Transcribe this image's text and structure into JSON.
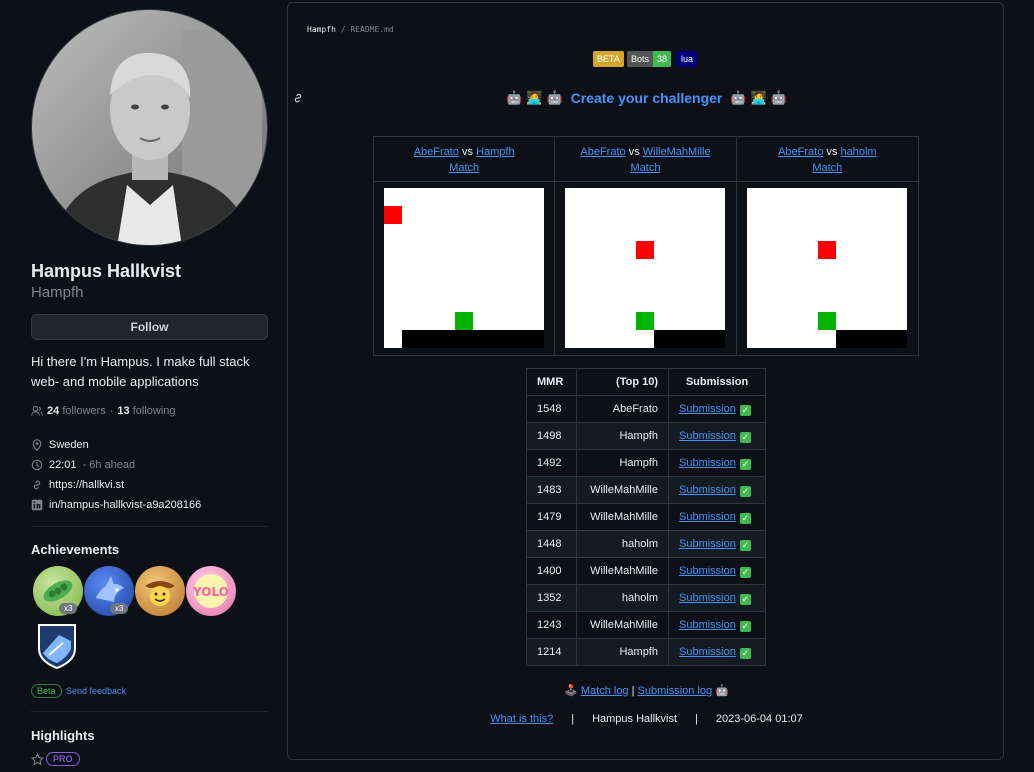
{
  "profile": {
    "name": "Hampus Hallkvist",
    "username": "Hampfh",
    "follow_label": "Follow",
    "bio": "Hi there I'm Hampus. I make full stack web- and mobile applications",
    "followers_count": "24",
    "followers_label": "followers",
    "dot": "·",
    "following_count": "13",
    "following_label": "following",
    "location": "Sweden",
    "time": "22:01",
    "time_note": "- 6h ahead",
    "website": "https://hallkvi.st",
    "linkedin": "in/hampus-hallkvist-a9a208166"
  },
  "achievements": {
    "title": "Achievements",
    "badges": [
      {
        "icon": "pair-extraordinaire-icon",
        "count": "x3",
        "color": "#8bc34a"
      },
      {
        "icon": "shark-icon",
        "count": "x3",
        "color": "#1e4fb4"
      },
      {
        "icon": "cowboy-icon",
        "count": "",
        "color": "#d8a24a"
      },
      {
        "icon": "yolo-icon",
        "count": "",
        "color": "#f08fbf"
      },
      {
        "icon": "arctic-code-vault-icon",
        "count": "",
        "color": "#1f3a6e"
      }
    ],
    "beta_label": "Beta",
    "feedback_label": "Send feedback"
  },
  "highlights": {
    "title": "Highlights",
    "pro_label": "PRO"
  },
  "readme": {
    "owner": "Hampfh",
    "slash": "/",
    "file": "README.md",
    "shields": [
      {
        "label": "BETA",
        "color": "#d4a72c"
      },
      {
        "label": "Bots",
        "value": "38",
        "color": "#555555",
        "value_color": "#3fb950"
      },
      {
        "label": "lua",
        "color": "#000080"
      }
    ],
    "challenge_text": "Create your challenger",
    "matches": [
      {
        "p1": "AbeFrato",
        "vs": "vs",
        "p2": "Hampfh",
        "match": "Match"
      },
      {
        "p1": "AbeFrato",
        "vs": "vs",
        "p2": "WilleMahMille",
        "match": "Match"
      },
      {
        "p1": "AbeFrato",
        "vs": "vs",
        "p2": "haholm",
        "match": "Match"
      }
    ],
    "table": {
      "headers": [
        "MMR",
        "(Top 10)",
        "Submission"
      ],
      "rows": [
        {
          "mmr": "1548",
          "name": "AbeFrato",
          "link": "Submission"
        },
        {
          "mmr": "1498",
          "name": "Hampfh",
          "link": "Submission"
        },
        {
          "mmr": "1492",
          "name": "Hampfh",
          "link": "Submission"
        },
        {
          "mmr": "1483",
          "name": "WilleMahMille",
          "link": "Submission"
        },
        {
          "mmr": "1479",
          "name": "WilleMahMille",
          "link": "Submission"
        },
        {
          "mmr": "1448",
          "name": "haholm",
          "link": "Submission"
        },
        {
          "mmr": "1400",
          "name": "WilleMahMille",
          "link": "Submission"
        },
        {
          "mmr": "1352",
          "name": "haholm",
          "link": "Submission"
        },
        {
          "mmr": "1243",
          "name": "WilleMahMille",
          "link": "Submission"
        },
        {
          "mmr": "1214",
          "name": "Hampfh",
          "link": "Submission"
        }
      ]
    },
    "match_log": "Match log",
    "pipe": "|",
    "submission_log": "Submission log",
    "footer": {
      "what": "What is this?",
      "sep": "|",
      "author": "Hampus Hallkvist",
      "date": "2023-06-04 01:07"
    }
  },
  "colors": {
    "link": "#4493f8",
    "red": "#ff0000",
    "green": "#00b400",
    "check": "#3fb950"
  }
}
